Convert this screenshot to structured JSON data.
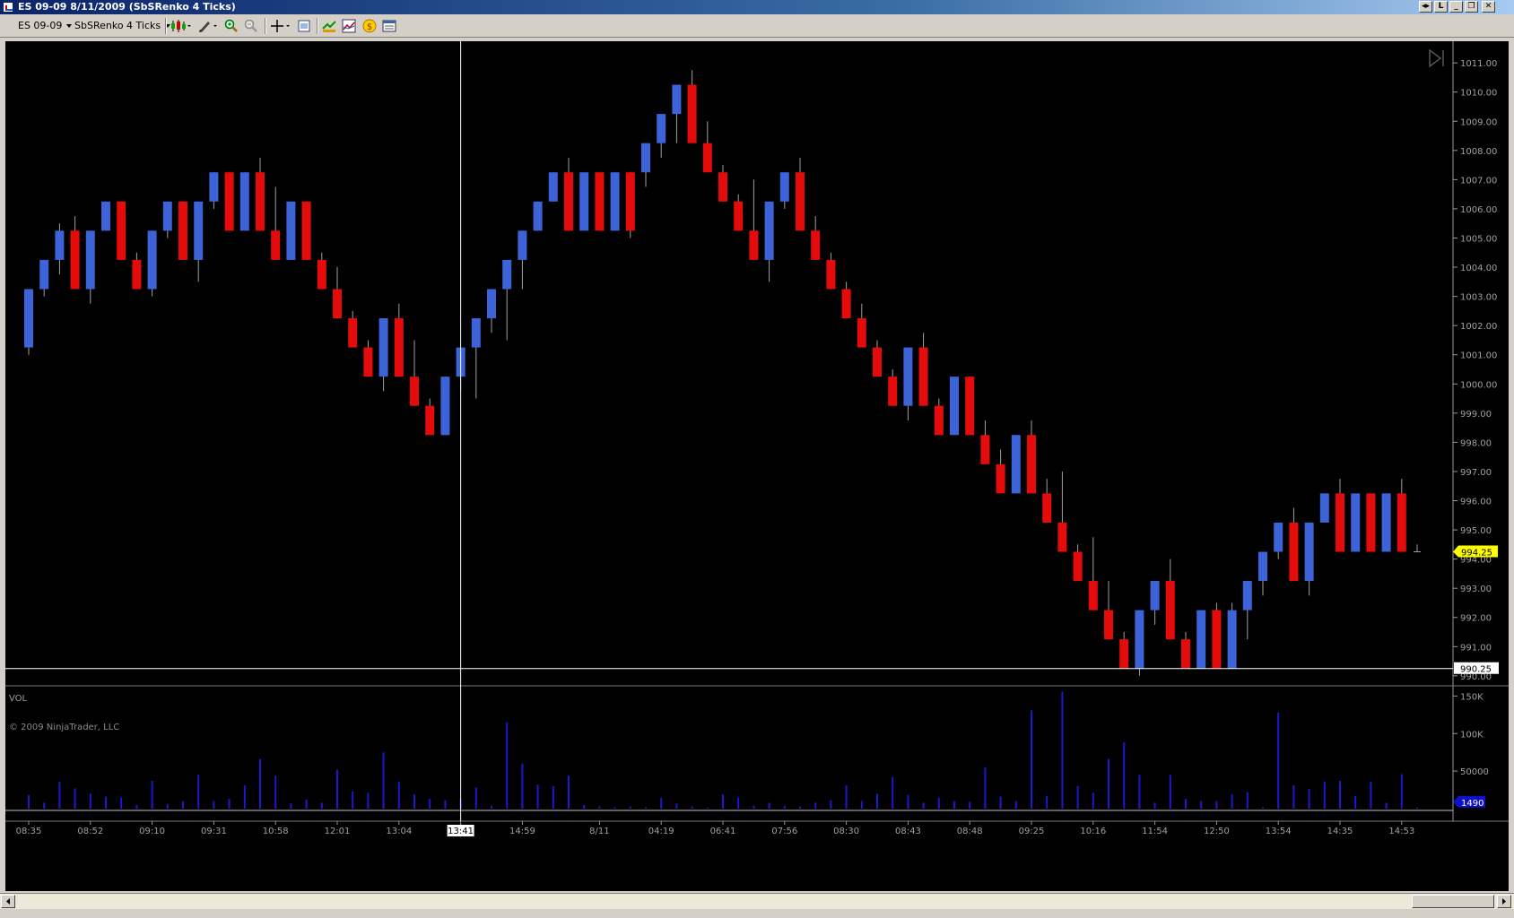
{
  "window": {
    "title": "ES 09-09  8/11/2009 (SbSRenko 4 Ticks)",
    "buttons": [
      "◂▸",
      "L",
      "_",
      "❐",
      "✕"
    ]
  },
  "toolbar": {
    "instrument": "ES 09-09",
    "bar_type": "SbSRenko 4 Ticks",
    "icons": [
      "candlestick-style-icon",
      "pencil-draw-icon",
      "zoom-in-icon",
      "zoom-out-icon",
      "crosshair-icon",
      "properties-icon",
      "data-box-icon",
      "indicators-icon",
      "strategy-icon",
      "chart-properties-icon"
    ]
  },
  "colors": {
    "background": "#000000",
    "up_bar": "#3d63d8",
    "down_bar": "#e60b0b",
    "wick": "#a0a0a0",
    "volume": "#1a1ad0",
    "crosshair": "#ffffff",
    "last_price_marker": "#ffff00",
    "volume_marker": "#1010c8"
  },
  "copyright": "© 2009 NinjaTrader, LLC",
  "chart_data": [
    {
      "type": "candlestick",
      "subtype": "renko",
      "ylim": [
        989.75,
        1011.25
      ],
      "yticks": [
        "1011.00",
        "1010.00",
        "1009.00",
        "1008.00",
        "1007.00",
        "1006.00",
        "1005.00",
        "1004.00",
        "1003.00",
        "1002.00",
        "1001.00",
        "1000.00",
        "999.00",
        "998.00",
        "997.00",
        "996.00",
        "995.00",
        "994.00",
        "993.00",
        "992.00",
        "991.00",
        "990.00"
      ],
      "xticks": [
        {
          "i": 0,
          "label": "08:35"
        },
        {
          "i": 4,
          "label": "08:52"
        },
        {
          "i": 8,
          "label": "09:10"
        },
        {
          "i": 12,
          "label": "09:31"
        },
        {
          "i": 16,
          "label": "10:58"
        },
        {
          "i": 20,
          "label": "12:01"
        },
        {
          "i": 24,
          "label": "13:04"
        },
        {
          "i": 28,
          "label": "13:41"
        },
        {
          "i": 32,
          "label": "14:59"
        },
        {
          "i": 37,
          "label": "8/11"
        },
        {
          "i": 41,
          "label": "04:19"
        },
        {
          "i": 45,
          "label": "06:41"
        },
        {
          "i": 49,
          "label": "07:56"
        },
        {
          "i": 53,
          "label": "08:30"
        },
        {
          "i": 57,
          "label": "08:43"
        },
        {
          "i": 61,
          "label": "08:48"
        },
        {
          "i": 65,
          "label": "09:25"
        },
        {
          "i": 69,
          "label": "10:16"
        },
        {
          "i": 73,
          "label": "11:54"
        },
        {
          "i": 77,
          "label": "12:50"
        },
        {
          "i": 81,
          "label": "13:54"
        },
        {
          "i": 85,
          "label": "14:35"
        },
        {
          "i": 89,
          "label": "14:53"
        }
      ],
      "highlight_xtick": "13:41",
      "crosshair_index": 28,
      "crosshair_price": "990.25",
      "crosshair_price_value": 990.25,
      "last_price": "994.25",
      "last_price_value": 994.25,
      "bars": [
        {
          "open": 1001.25,
          "close": 1003.25,
          "high": 1003.25,
          "low": 1001.0
        },
        {
          "open": 1003.25,
          "close": 1004.25,
          "high": 1004.25,
          "low": 1003.0
        },
        {
          "open": 1004.25,
          "close": 1005.25,
          "high": 1005.5,
          "low": 1003.75
        },
        {
          "open": 1005.25,
          "close": 1003.25,
          "high": 1005.75,
          "low": 1003.25
        },
        {
          "open": 1003.25,
          "close": 1005.25,
          "high": 1005.25,
          "low": 1002.75
        },
        {
          "open": 1005.25,
          "close": 1006.25,
          "high": 1006.25,
          "low": 1005.25
        },
        {
          "open": 1006.25,
          "close": 1004.25,
          "high": 1006.25,
          "low": 1004.25
        },
        {
          "open": 1004.25,
          "close": 1003.25,
          "high": 1004.5,
          "low": 1003.25
        },
        {
          "open": 1003.25,
          "close": 1005.25,
          "high": 1005.25,
          "low": 1003.0
        },
        {
          "open": 1005.25,
          "close": 1006.25,
          "high": 1006.25,
          "low": 1005.0
        },
        {
          "open": 1006.25,
          "close": 1004.25,
          "high": 1006.25,
          "low": 1004.25
        },
        {
          "open": 1004.25,
          "close": 1006.25,
          "high": 1006.25,
          "low": 1003.5
        },
        {
          "open": 1006.25,
          "close": 1007.25,
          "high": 1007.25,
          "low": 1006.0
        },
        {
          "open": 1007.25,
          "close": 1005.25,
          "high": 1007.25,
          "low": 1005.25
        },
        {
          "open": 1005.25,
          "close": 1007.25,
          "high": 1007.25,
          "low": 1005.25
        },
        {
          "open": 1007.25,
          "close": 1005.25,
          "high": 1007.75,
          "low": 1005.25
        },
        {
          "open": 1005.25,
          "close": 1004.25,
          "high": 1006.75,
          "low": 1004.25
        },
        {
          "open": 1004.25,
          "close": 1006.25,
          "high": 1006.25,
          "low": 1004.25
        },
        {
          "open": 1006.25,
          "close": 1004.25,
          "high": 1006.25,
          "low": 1004.25
        },
        {
          "open": 1004.25,
          "close": 1003.25,
          "high": 1004.5,
          "low": 1003.25
        },
        {
          "open": 1003.25,
          "close": 1002.25,
          "high": 1004.0,
          "low": 1002.25
        },
        {
          "open": 1002.25,
          "close": 1001.25,
          "high": 1002.5,
          "low": 1001.25
        },
        {
          "open": 1001.25,
          "close": 1000.25,
          "high": 1001.5,
          "low": 1000.25
        },
        {
          "open": 1000.25,
          "close": 1002.25,
          "high": 1002.25,
          "low": 999.75
        },
        {
          "open": 1002.25,
          "close": 1000.25,
          "high": 1002.75,
          "low": 1000.25
        },
        {
          "open": 1000.25,
          "close": 999.25,
          "high": 1001.5,
          "low": 999.25
        },
        {
          "open": 999.25,
          "close": 998.25,
          "high": 999.5,
          "low": 998.25
        },
        {
          "open": 998.25,
          "close": 1000.25,
          "high": 1000.25,
          "low": 998.25
        },
        {
          "open": 1000.25,
          "close": 1001.25,
          "high": 1001.25,
          "low": 999.75
        },
        {
          "open": 1001.25,
          "close": 1002.25,
          "high": 1002.25,
          "low": 999.5
        },
        {
          "open": 1002.25,
          "close": 1003.25,
          "high": 1003.25,
          "low": 1001.75
        },
        {
          "open": 1003.25,
          "close": 1004.25,
          "high": 1004.25,
          "low": 1001.5
        },
        {
          "open": 1004.25,
          "close": 1005.25,
          "high": 1005.25,
          "low": 1003.25
        },
        {
          "open": 1005.25,
          "close": 1006.25,
          "high": 1006.25,
          "low": 1005.25
        },
        {
          "open": 1006.25,
          "close": 1007.25,
          "high": 1007.25,
          "low": 1006.25
        },
        {
          "open": 1007.25,
          "close": 1005.25,
          "high": 1007.75,
          "low": 1005.25
        },
        {
          "open": 1005.25,
          "close": 1007.25,
          "high": 1007.25,
          "low": 1005.25
        },
        {
          "open": 1007.25,
          "close": 1005.25,
          "high": 1007.25,
          "low": 1005.25
        },
        {
          "open": 1005.25,
          "close": 1007.25,
          "high": 1007.25,
          "low": 1005.25
        },
        {
          "open": 1007.25,
          "close": 1005.25,
          "high": 1007.25,
          "low": 1005.0
        },
        {
          "open": 1007.25,
          "close": 1008.25,
          "high": 1008.25,
          "low": 1006.75
        },
        {
          "open": 1008.25,
          "close": 1009.25,
          "high": 1009.25,
          "low": 1007.75
        },
        {
          "open": 1009.25,
          "close": 1010.25,
          "high": 1010.25,
          "low": 1008.25
        },
        {
          "open": 1010.25,
          "close": 1008.25,
          "high": 1010.75,
          "low": 1008.25
        },
        {
          "open": 1008.25,
          "close": 1007.25,
          "high": 1009.0,
          "low": 1007.25
        },
        {
          "open": 1007.25,
          "close": 1006.25,
          "high": 1007.5,
          "low": 1006.25
        },
        {
          "open": 1006.25,
          "close": 1005.25,
          "high": 1006.5,
          "low": 1005.25
        },
        {
          "open": 1005.25,
          "close": 1004.25,
          "high": 1007.0,
          "low": 1004.25
        },
        {
          "open": 1004.25,
          "close": 1006.25,
          "high": 1006.25,
          "low": 1003.5
        },
        {
          "open": 1006.25,
          "close": 1007.25,
          "high": 1007.25,
          "low": 1006.0
        },
        {
          "open": 1007.25,
          "close": 1005.25,
          "high": 1007.75,
          "low": 1005.25
        },
        {
          "open": 1005.25,
          "close": 1004.25,
          "high": 1005.75,
          "low": 1004.25
        },
        {
          "open": 1004.25,
          "close": 1003.25,
          "high": 1004.5,
          "low": 1003.25
        },
        {
          "open": 1003.25,
          "close": 1002.25,
          "high": 1003.5,
          "low": 1002.25
        },
        {
          "open": 1002.25,
          "close": 1001.25,
          "high": 1002.75,
          "low": 1001.25
        },
        {
          "open": 1001.25,
          "close": 1000.25,
          "high": 1001.5,
          "low": 1000.25
        },
        {
          "open": 1000.25,
          "close": 999.25,
          "high": 1000.5,
          "low": 999.25
        },
        {
          "open": 999.25,
          "close": 1001.25,
          "high": 1001.25,
          "low": 998.75
        },
        {
          "open": 1001.25,
          "close": 999.25,
          "high": 1001.75,
          "low": 999.25
        },
        {
          "open": 999.25,
          "close": 998.25,
          "high": 999.5,
          "low": 998.25
        },
        {
          "open": 998.25,
          "close": 1000.25,
          "high": 1000.25,
          "low": 998.25
        },
        {
          "open": 1000.25,
          "close": 998.25,
          "high": 1000.25,
          "low": 998.25
        },
        {
          "open": 998.25,
          "close": 997.25,
          "high": 998.75,
          "low": 997.25
        },
        {
          "open": 997.25,
          "close": 996.25,
          "high": 997.75,
          "low": 996.25
        },
        {
          "open": 996.25,
          "close": 998.25,
          "high": 998.25,
          "low": 996.25
        },
        {
          "open": 998.25,
          "close": 996.25,
          "high": 998.75,
          "low": 996.25
        },
        {
          "open": 996.25,
          "close": 995.25,
          "high": 996.75,
          "low": 995.25
        },
        {
          "open": 995.25,
          "close": 994.25,
          "high": 997.0,
          "low": 994.25
        },
        {
          "open": 994.25,
          "close": 993.25,
          "high": 994.5,
          "low": 993.25
        },
        {
          "open": 993.25,
          "close": 992.25,
          "high": 994.75,
          "low": 992.25
        },
        {
          "open": 992.25,
          "close": 991.25,
          "high": 993.25,
          "low": 991.25
        },
        {
          "open": 991.25,
          "close": 990.25,
          "high": 991.5,
          "low": 990.25
        },
        {
          "open": 990.25,
          "close": 992.25,
          "high": 992.25,
          "low": 990.0
        },
        {
          "open": 992.25,
          "close": 993.25,
          "high": 993.25,
          "low": 991.75
        },
        {
          "open": 993.25,
          "close": 991.25,
          "high": 994.0,
          "low": 991.25
        },
        {
          "open": 991.25,
          "close": 990.25,
          "high": 991.5,
          "low": 990.25
        },
        {
          "open": 990.25,
          "close": 992.25,
          "high": 992.25,
          "low": 990.25
        },
        {
          "open": 992.25,
          "close": 990.25,
          "high": 992.5,
          "low": 990.25
        },
        {
          "open": 990.25,
          "close": 992.25,
          "high": 992.5,
          "low": 990.25
        },
        {
          "open": 992.25,
          "close": 993.25,
          "high": 993.25,
          "low": 991.25
        },
        {
          "open": 993.25,
          "close": 994.25,
          "high": 994.25,
          "low": 992.75
        },
        {
          "open": 994.25,
          "close": 995.25,
          "high": 995.25,
          "low": 994.0
        },
        {
          "open": 995.25,
          "close": 993.25,
          "high": 995.75,
          "low": 993.25
        },
        {
          "open": 993.25,
          "close": 995.25,
          "high": 995.25,
          "low": 992.75
        },
        {
          "open": 995.25,
          "close": 996.25,
          "high": 996.25,
          "low": 995.25
        },
        {
          "open": 996.25,
          "close": 994.25,
          "high": 996.75,
          "low": 994.25
        },
        {
          "open": 994.25,
          "close": 996.25,
          "high": 996.25,
          "low": 994.25
        },
        {
          "open": 996.25,
          "close": 994.25,
          "high": 996.25,
          "low": 994.25
        },
        {
          "open": 994.25,
          "close": 996.25,
          "high": 996.25,
          "low": 994.25
        },
        {
          "open": 996.25,
          "close": 994.25,
          "high": 996.75,
          "low": 994.25
        },
        {
          "open": 994.25,
          "close": 994.25,
          "high": 994.5,
          "low": 994.25
        }
      ]
    },
    {
      "type": "bar",
      "title": "VOL",
      "ylim": [
        0,
        160000
      ],
      "yticks": [
        "150K",
        "100K",
        "50000"
      ],
      "ytick_values": [
        150000,
        100000,
        50000
      ],
      "last_value": "1490",
      "last_value_num": 1490,
      "values": [
        18000,
        8000,
        36000,
        27000,
        20000,
        16000,
        15000,
        5000,
        37000,
        6000,
        10000,
        45000,
        10000,
        13000,
        31000,
        66000,
        44000,
        7000,
        12000,
        8000,
        52000,
        23000,
        21000,
        75000,
        36000,
        19000,
        13000,
        11000,
        13000,
        28000,
        4000,
        115000,
        60000,
        32000,
        30000,
        44000,
        5000,
        3000,
        2000,
        3000,
        2000,
        14000,
        7000,
        3000,
        1490,
        19000,
        15000,
        4000,
        8000,
        4000,
        3000,
        8000,
        11000,
        31000,
        10000,
        20000,
        42000,
        18000,
        8000,
        14000,
        10000,
        9000,
        55000,
        16000,
        10000,
        131000,
        17000,
        156000,
        30000,
        21000,
        66000,
        88000,
        45000,
        8000,
        45000,
        13000,
        10000,
        10000,
        19000,
        22000,
        2000,
        128000,
        31000,
        26000,
        36000,
        37000,
        17000,
        36000,
        8000,
        46000,
        1490
      ]
    }
  ]
}
